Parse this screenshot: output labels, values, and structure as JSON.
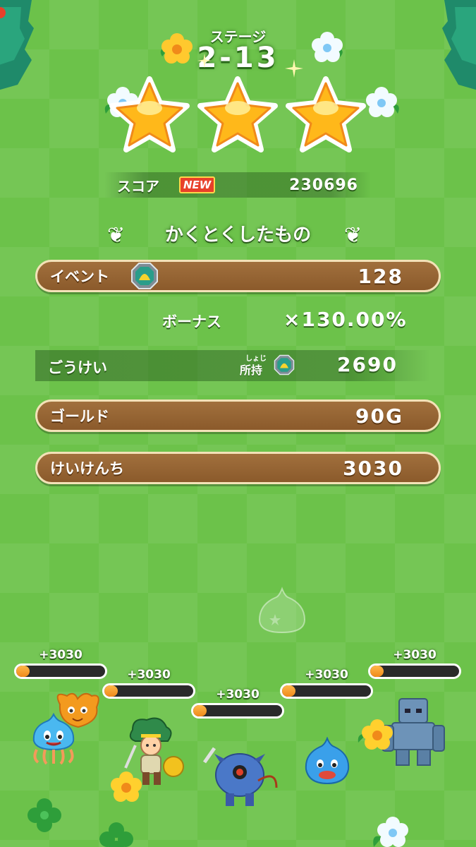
{
  "stage": {
    "label": "ステージ",
    "number": "2-13"
  },
  "stars_earned": 3,
  "score": {
    "label": "スコア",
    "badge": "NEW",
    "value": "230696"
  },
  "rewards_title": "かくとくしたもの",
  "event": {
    "label": "イベント",
    "value": "128",
    "icon": "event-gem-icon"
  },
  "bonus": {
    "label": "ボーナス",
    "value": "×130.00%"
  },
  "total": {
    "label": "ごうけい",
    "owned_ruby": "しょじ",
    "owned_label": "所持",
    "value": "2690"
  },
  "gold": {
    "label": "ゴールド",
    "value": "90G"
  },
  "experience": {
    "label": "けいけんち",
    "value": "3030"
  },
  "party": [
    {
      "name": "healslime",
      "xp_gain": "+3030",
      "fill": 0.15
    },
    {
      "name": "hero",
      "xp_gain": "+3030",
      "fill": 0.15
    },
    {
      "name": "killing-machine",
      "xp_gain": "+3030",
      "fill": 0.15
    },
    {
      "name": "slime",
      "xp_gain": "+3030",
      "fill": 0.15
    },
    {
      "name": "golem",
      "xp_gain": "+3030",
      "fill": 0.15
    }
  ],
  "colors": {
    "grass": "#6cc24a",
    "wood": "#8b5a2b",
    "xp_fill": "#f08a1a",
    "star": "#ffc21a"
  }
}
